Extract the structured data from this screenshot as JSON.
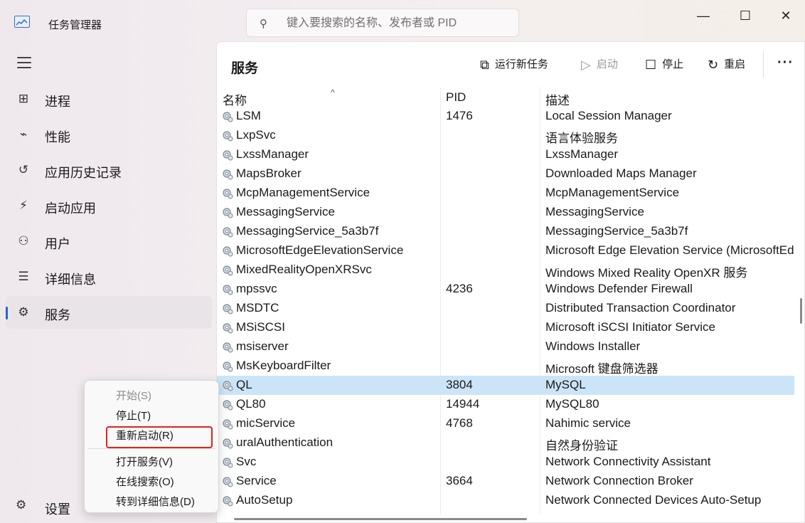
{
  "window": {
    "title": "任务管理器",
    "search_placeholder": "键入要搜索的名称、发布者或 PID",
    "minimize": "—",
    "maximize": "☐",
    "close": "✕"
  },
  "sidebar": {
    "items": [
      {
        "icon": "processes-icon",
        "glyph": "⊞",
        "label": "进程"
      },
      {
        "icon": "performance-icon",
        "glyph": "⌁",
        "label": "性能"
      },
      {
        "icon": "history-icon",
        "glyph": "↺",
        "label": "应用历史记录"
      },
      {
        "icon": "startup-icon",
        "glyph": "⚡",
        "label": "启动应用"
      },
      {
        "icon": "users-icon",
        "glyph": "⚇",
        "label": "用户"
      },
      {
        "icon": "details-icon",
        "glyph": "☰",
        "label": "详细信息"
      },
      {
        "icon": "services-icon",
        "glyph": "⚙",
        "label": "服务",
        "active": true
      }
    ],
    "settings": {
      "icon": "gear-icon",
      "glyph": "⚙",
      "label": "设置"
    }
  },
  "panel": {
    "title": "服务",
    "toolbar": {
      "run_new_task": "运行新任务",
      "start": "启动",
      "stop": "停止",
      "restart": "重启",
      "more": "···"
    },
    "columns": {
      "name": "名称",
      "pid": "PID",
      "description": "描述"
    },
    "rows": [
      {
        "name": "LSM",
        "pid": "1476",
        "desc": "Local Session Manager"
      },
      {
        "name": "LxpSvc",
        "pid": "",
        "desc": "语言体验服务"
      },
      {
        "name": "LxssManager",
        "pid": "",
        "desc": "LxssManager"
      },
      {
        "name": "MapsBroker",
        "pid": "",
        "desc": "Downloaded Maps Manager"
      },
      {
        "name": "McpManagementService",
        "pid": "",
        "desc": "McpManagementService"
      },
      {
        "name": "MessagingService",
        "pid": "",
        "desc": "MessagingService"
      },
      {
        "name": "MessagingService_5a3b7f",
        "pid": "",
        "desc": "MessagingService_5a3b7f"
      },
      {
        "name": "MicrosoftEdgeElevationService",
        "pid": "",
        "desc": "Microsoft Edge Elevation Service (MicrosoftEdgeElevationService)"
      },
      {
        "name": "MixedRealityOpenXRSvc",
        "pid": "",
        "desc": "Windows Mixed Reality OpenXR 服务"
      },
      {
        "name": "mpssvc",
        "pid": "4236",
        "desc": "Windows Defender Firewall"
      },
      {
        "name": "MSDTC",
        "pid": "",
        "desc": "Distributed Transaction Coordinator"
      },
      {
        "name": "MSiSCSI",
        "pid": "",
        "desc": "Microsoft iSCSI Initiator Service"
      },
      {
        "name": "msiserver",
        "pid": "",
        "desc": "Windows Installer"
      },
      {
        "name": "MsKeyboardFilter",
        "pid": "",
        "desc": "Microsoft 键盘筛选器"
      },
      {
        "name": "QL",
        "pid": "3804",
        "desc": "MySQL",
        "selected": true
      },
      {
        "name": "QL80",
        "pid": "14944",
        "desc": "MySQL80"
      },
      {
        "name": "micService",
        "pid": "4768",
        "desc": "Nahimic service"
      },
      {
        "name": "uralAuthentication",
        "pid": "",
        "desc": "自然身份验证"
      },
      {
        "name": "Svc",
        "pid": "",
        "desc": "Network Connectivity Assistant"
      },
      {
        "name": "Service",
        "pid": "3664",
        "desc": "Network Connection Broker"
      },
      {
        "name": "AutoSetup",
        "pid": "",
        "desc": "Network Connected Devices Auto-Setup"
      }
    ]
  },
  "context_menu": {
    "items": [
      {
        "label": "开始(S)",
        "disabled": true
      },
      {
        "label": "停止(T)"
      },
      {
        "label": "重新启动(R)",
        "highlighted": true
      },
      {
        "label": "打开服务(V)"
      },
      {
        "label": "在线搜索(O)"
      },
      {
        "label": "转到详细信息(D)"
      }
    ]
  },
  "colors": {
    "accent": "#2b63c9",
    "selection": "#cce4f7",
    "highlight_box": "#e2231a"
  }
}
